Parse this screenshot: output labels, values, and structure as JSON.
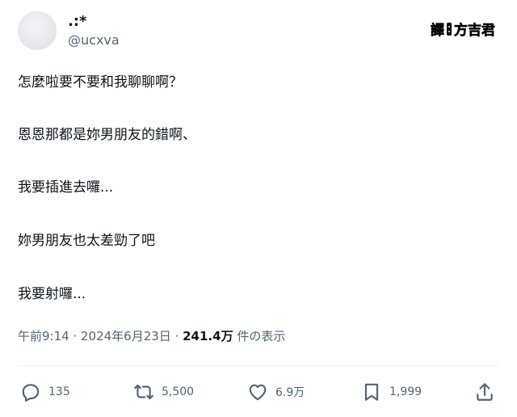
{
  "user": {
    "display_name": ".:*",
    "handle": "@ucxva"
  },
  "watermark": {
    "part1": "譯",
    "part2": "方吉君"
  },
  "tweet": {
    "lines": [
      "怎麼啦要不要和我聊聊啊？",
      "恩恩那都是妳男朋友的錯啊、",
      "我要插進去囉...",
      "妳男朋友也太差勁了吧",
      "我要射囉..."
    ],
    "time": "午前9:14",
    "separator": " · ",
    "date": "2024年6月23日",
    "views_count": "241.4万",
    "views_label": " 件の表示"
  },
  "actions": {
    "reply": {
      "icon": "reply-icon",
      "count": "135"
    },
    "retweet": {
      "icon": "retweet-icon",
      "count": "5,500"
    },
    "like": {
      "icon": "heart-icon",
      "count": "6.9万"
    },
    "bookmark": {
      "icon": "bookmark-icon",
      "count": "1,999"
    },
    "share": {
      "icon": "share-icon"
    }
  }
}
